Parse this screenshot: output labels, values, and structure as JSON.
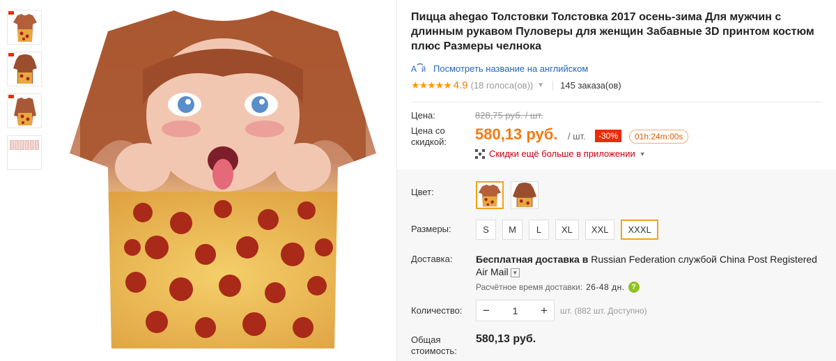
{
  "product": {
    "title": "Пицца ahegao Толстовки Толстовка 2017 осень-зима Для мужчин с длинным рукавом Пуловеры для женщин Забавные 3D принтом костюм плюс Размеры челнока",
    "translate_link": "Посмотреть название на английском",
    "translate_icon": "translate-icon",
    "stars": "★★★★★",
    "rating": "4.9",
    "votes": "(18 голоса(ов))",
    "orders": "145 заказа(ов)"
  },
  "price": {
    "label_price": "Цена:",
    "old_price": "828,75 руб. / шт.",
    "label_discount_price": "Цена со скидкой:",
    "new_price": "580,13 руб.",
    "per_unit": "/ шт.",
    "discount": "-30%",
    "timer": "01h:24m:00s",
    "app_discount": "Скидки ещё больше в приложении"
  },
  "options": {
    "color_label": "Цвет:",
    "colors": [
      "tshirt-variant",
      "hoodie-variant"
    ],
    "selected_color": 0,
    "size_label": "Размеры:",
    "sizes": [
      "S",
      "M",
      "L",
      "XL",
      "XXL",
      "XXXL"
    ],
    "selected_size": "XXXL"
  },
  "shipping": {
    "label": "Доставка:",
    "free": "Бесплатная доставка в",
    "destination": "Russian Federation",
    "via": "службой",
    "carrier": "China Post Registered Air Mail",
    "eta_label": "Расчётное время доставки:",
    "eta_days": "26-48 дн."
  },
  "quantity": {
    "label": "Количество:",
    "value": "1",
    "minus": "−",
    "plus": "+",
    "note": "шт. (882 шт. Доступно)"
  },
  "total": {
    "label": "Общая стоимость:",
    "value": "580,13 руб."
  },
  "colors": {
    "accent_orange": "#f27a14",
    "discount_red": "#e62e04",
    "star_orange": "#ff9a00",
    "link_blue": "#2266bb",
    "selected_border": "#f0a020"
  }
}
